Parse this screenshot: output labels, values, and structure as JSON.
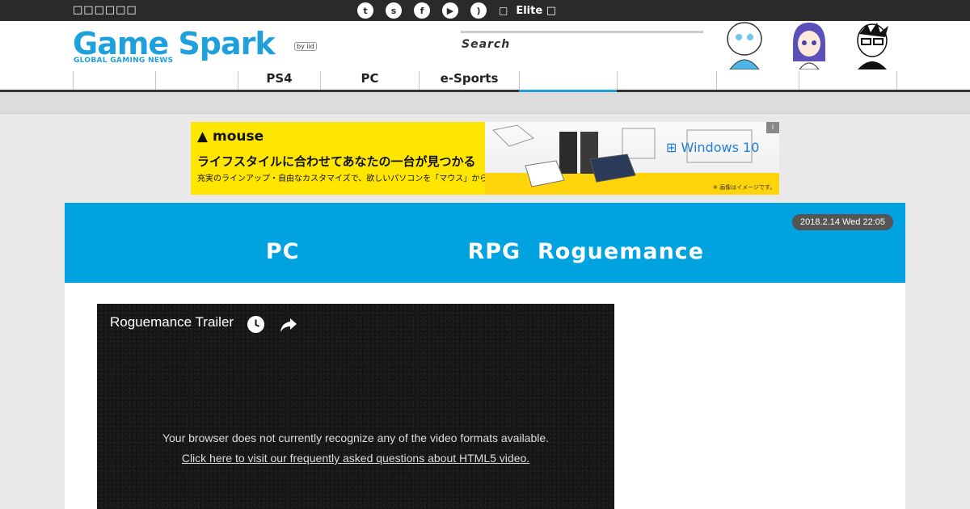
{
  "topbar": {
    "left_text": "□□□□□□",
    "social_icons": [
      {
        "name": "twitter-icon",
        "glyph": "t"
      },
      {
        "name": "steam-icon",
        "glyph": "s"
      },
      {
        "name": "facebook-icon",
        "glyph": "f"
      },
      {
        "name": "youtube-icon",
        "glyph": "▶"
      },
      {
        "name": "rss-icon",
        "glyph": ")"
      }
    ],
    "lock_glyph": "□",
    "elite_label": "Elite □"
  },
  "header": {
    "logo_text": "Game Spark",
    "logo_subtitle": "GLOBAL GAMING NEWS",
    "logo_badge": "by iid",
    "search_label": "Search"
  },
  "nav": {
    "items": [
      {
        "label": ""
      },
      {
        "label": ""
      },
      {
        "label": "PS4"
      },
      {
        "label": "PC"
      },
      {
        "label": "e-Sports"
      },
      {
        "label": ""
      },
      {
        "label": ""
      },
      {
        "label": ""
      },
      {
        "label": ""
      }
    ],
    "active_index": 5
  },
  "ad": {
    "brand": "mouse",
    "headline": "ライフスタイルに合わせてあなたの一台が見つかる",
    "subline": "充実のラインアップ・自由なカスタマイズで、欲しいパソコンを「マウス」から",
    "windows_label": "Windows 10",
    "note": "※ 画像はイメージです。",
    "info_glyph": "i"
  },
  "article": {
    "date": "2018.2.14 Wed 22:05",
    "title": "PC                    RPG  Roguemance"
  },
  "video": {
    "title": "Roguemance Trailer",
    "message": "Your browser does not currently recognize any of the video formats available.",
    "link": "Click here to visit our frequently asked questions about HTML5 video."
  },
  "colors": {
    "accent": "#1ea0dc",
    "banner": "#00a3e0",
    "topbar": "#2a2a2a"
  }
}
